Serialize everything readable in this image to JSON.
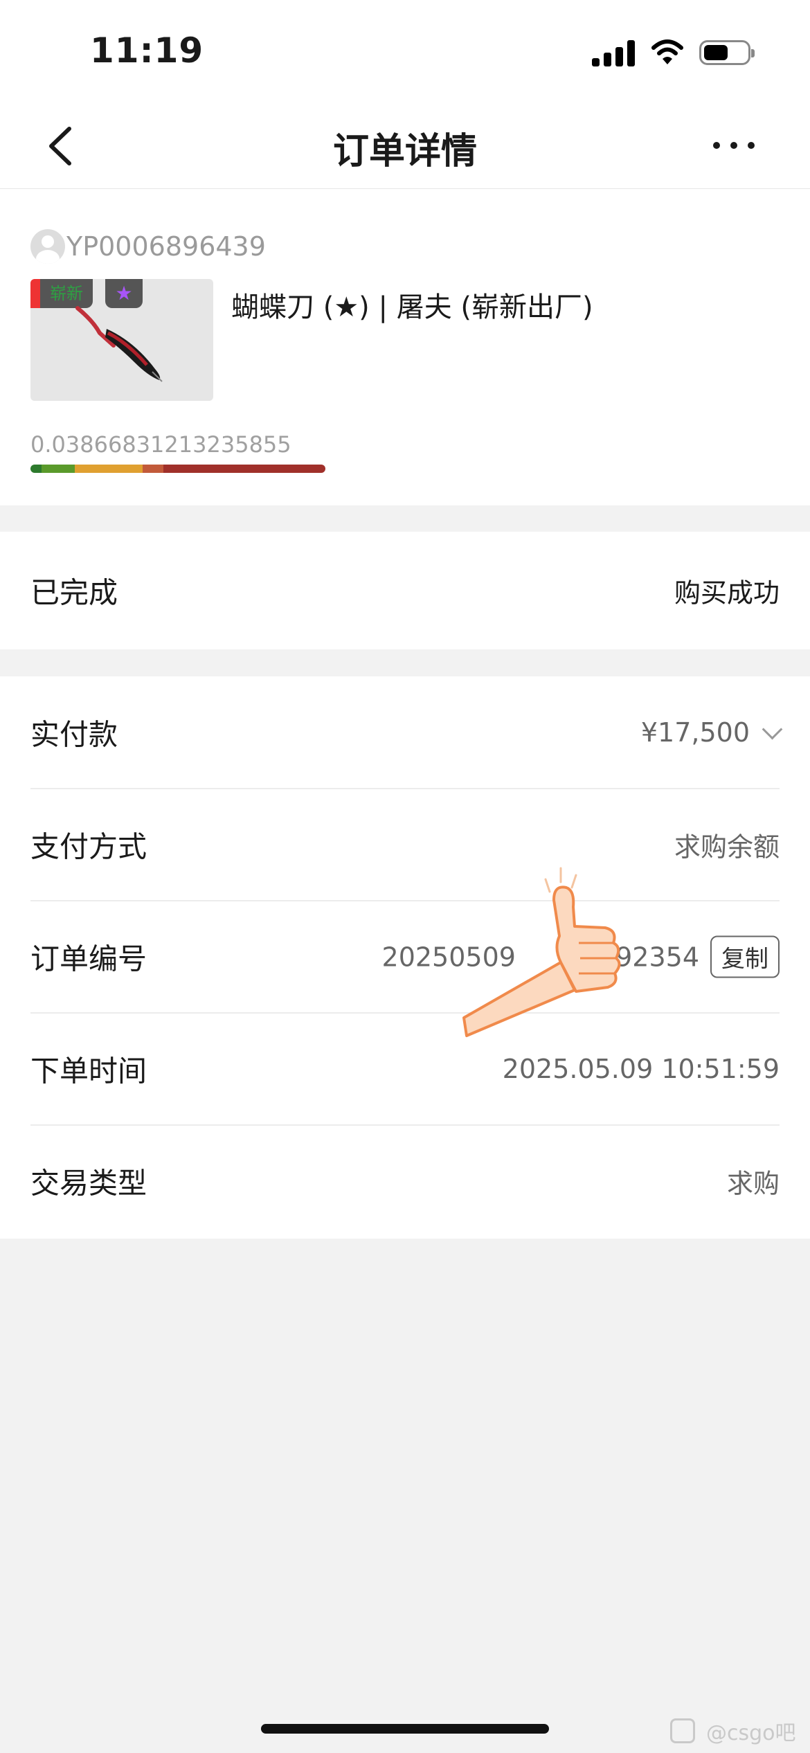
{
  "status_bar": {
    "time": "11:19"
  },
  "nav": {
    "title": "订单详情"
  },
  "item": {
    "seller_id": "YP0006896439",
    "name": "蝴蝶刀 (★) | 屠夫 (崭新出厂)",
    "tag_label": "崭新",
    "float_value": "0.03866831213235855",
    "wear_colors": [
      "#2d7a2d",
      "#5a9a2b",
      "#e0a030",
      "#c25a3a",
      "#a0302a"
    ]
  },
  "status": {
    "label": "已完成",
    "value": "购买成功"
  },
  "details": {
    "paid_label": "实付款",
    "paid_value": "¥17,500",
    "method_label": "支付方式",
    "method_value": "求购余额",
    "order_no_label": "订单编号",
    "order_no_value": "20250509",
    "order_no_tail": "292354",
    "copy_label": "复制",
    "time_label": "下单时间",
    "time_value": "2025.05.09 10:51:59",
    "type_label": "交易类型",
    "type_value": "求购"
  },
  "watermark": {
    "text": "@csgo吧"
  }
}
